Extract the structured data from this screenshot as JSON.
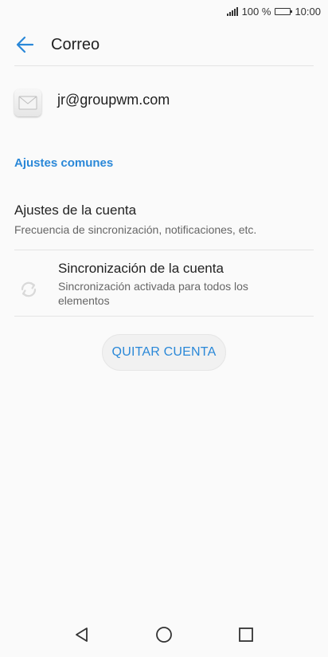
{
  "status_bar": {
    "battery_text": "100 %",
    "time": "10:00",
    "battery_level": 1.0
  },
  "app_bar": {
    "title": "Correo",
    "back_icon": "arrow-left-icon"
  },
  "account": {
    "email": "jr@groupwm.com",
    "icon": "mail-envelope-icon"
  },
  "section": {
    "header": "Ajustes comunes"
  },
  "settings": {
    "account_settings": {
      "title": "Ajustes de la cuenta",
      "subtitle": "Frecuencia de sincronización, notificaciones, etc."
    },
    "account_sync": {
      "title": "Sincronización de la cuenta",
      "subtitle": "Sincronización activada para todos los elementos",
      "icon": "sync-icon"
    }
  },
  "actions": {
    "remove_account": "QUITAR CUENTA"
  },
  "nav": {
    "back": "nav-back-icon",
    "home": "nav-home-icon",
    "recents": "nav-recents-icon"
  },
  "colors": {
    "accent": "#2a88d8",
    "background": "#fafafa"
  }
}
